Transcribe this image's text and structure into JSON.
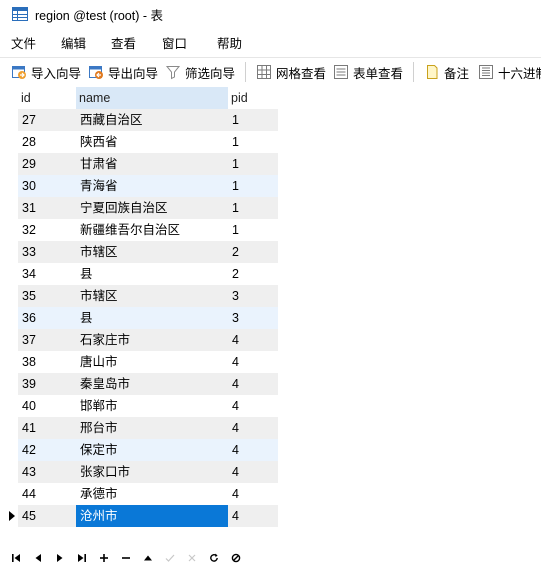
{
  "window": {
    "title": "region @test (root) - 表"
  },
  "menu": {
    "items": [
      "文件",
      "编辑",
      "查看",
      "窗口",
      "帮助"
    ]
  },
  "toolbar": {
    "import_label": "导入向导",
    "export_label": "导出向导",
    "filter_label": "筛选向导",
    "grid_view_label": "网格查看",
    "form_view_label": "表单查看",
    "memo_label": "备注",
    "hex_label": "十六进制"
  },
  "table": {
    "columns": [
      "id",
      "name",
      "pid"
    ],
    "rows": [
      [
        "27",
        "西藏自治区",
        "1"
      ],
      [
        "28",
        "陕西省",
        "1"
      ],
      [
        "29",
        "甘肃省",
        "1"
      ],
      [
        "30",
        "青海省",
        "1"
      ],
      [
        "31",
        "宁夏回族自治区",
        "1"
      ],
      [
        "32",
        "新疆维吾尔自治区",
        "1"
      ],
      [
        "33",
        "市辖区",
        "2"
      ],
      [
        "34",
        "县",
        "2"
      ],
      [
        "35",
        "市辖区",
        "3"
      ],
      [
        "36",
        "县",
        "3"
      ],
      [
        "37",
        "石家庄市",
        "4"
      ],
      [
        "38",
        "唐山市",
        "4"
      ],
      [
        "39",
        "秦皇岛市",
        "4"
      ],
      [
        "40",
        "邯郸市",
        "4"
      ],
      [
        "41",
        "邢台市",
        "4"
      ],
      [
        "42",
        "保定市",
        "4"
      ],
      [
        "43",
        "张家口市",
        "4"
      ],
      [
        "44",
        "承德市",
        "4"
      ],
      [
        "45",
        "沧州市",
        "4"
      ]
    ],
    "current_row_index": 18,
    "selected_cell": "name"
  },
  "colors": {
    "header_name_bg": "#d9e8f7",
    "row_band": "#efefef",
    "row_hover_band": "#eaf3fd",
    "selected_cell_bg": "#0a78d7"
  }
}
